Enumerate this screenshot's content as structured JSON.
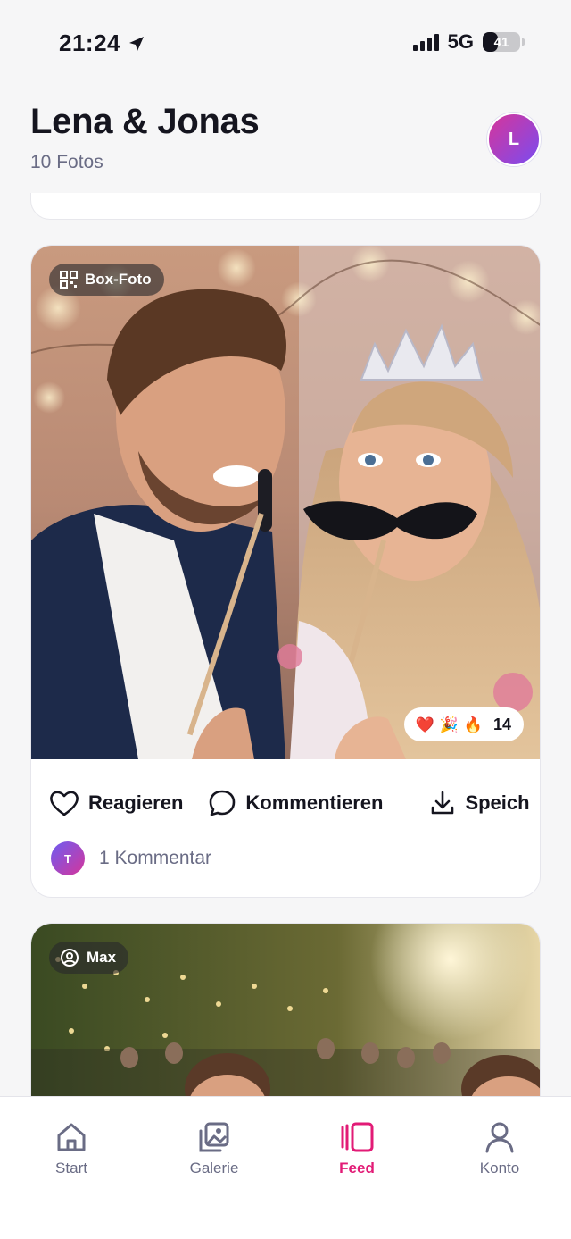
{
  "status": {
    "time": "21:24",
    "network": "5G",
    "battery": "41",
    "battery_level": 0.41
  },
  "header": {
    "title": "Lena & Jonas",
    "subtitle": "10 Fotos",
    "avatar_initial": "L"
  },
  "posts": [
    {
      "source_label": "Box-Foto",
      "source_icon": "qr-code-icon",
      "reactions": {
        "emojis": [
          "❤️",
          "🎉",
          "🔥"
        ],
        "count": "14"
      },
      "actions": {
        "react": "Reagieren",
        "comment": "Kommentieren",
        "save": "Speich"
      },
      "comment_avatar_initial": "T",
      "comment_count_label": "1 Kommentar"
    },
    {
      "source_label": "Max",
      "source_icon": "user-circle-icon"
    }
  ],
  "tabs": [
    {
      "label": "Start",
      "icon": "home-icon",
      "active": false
    },
    {
      "label": "Galerie",
      "icon": "gallery-icon",
      "active": false
    },
    {
      "label": "Feed",
      "icon": "feed-icon",
      "active": true
    },
    {
      "label": "Konto",
      "icon": "user-icon",
      "active": false
    }
  ],
  "colors": {
    "accent": "#e21b76",
    "muted_text": "#6a6c85",
    "avatar_gradient_start": "#d6359a",
    "avatar_gradient_end": "#7a4cf0"
  }
}
